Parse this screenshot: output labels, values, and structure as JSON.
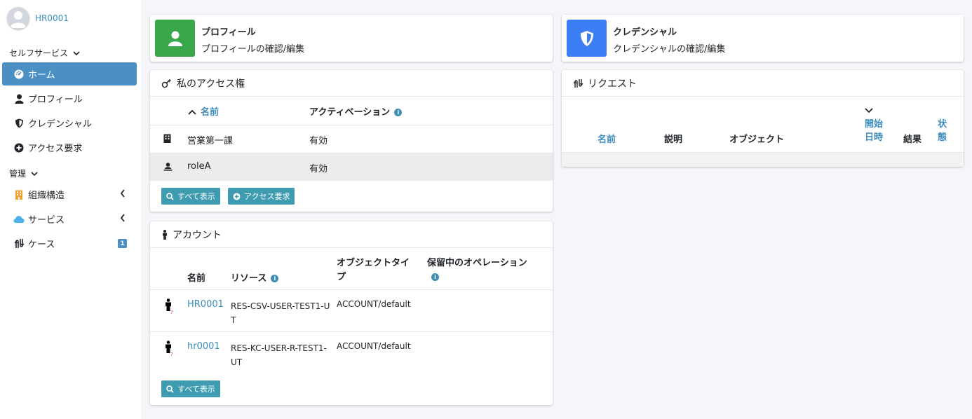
{
  "user": {
    "name": "HR0001"
  },
  "sidebar": {
    "self_service_label": "セルフサービス",
    "admin_label": "管理",
    "items": [
      {
        "label": "ホーム",
        "icon": "dashboard-icon",
        "active": true
      },
      {
        "label": "プロフィール",
        "icon": "user-icon"
      },
      {
        "label": "クレデンシャル",
        "icon": "shield-icon"
      },
      {
        "label": "アクセス要求",
        "icon": "plus-circle-icon"
      }
    ],
    "admin_items": [
      {
        "label": "組織構造",
        "icon": "building-icon"
      },
      {
        "label": "サービス",
        "icon": "cloud-icon"
      },
      {
        "label": "ケース",
        "icon": "case-icon",
        "badge": "1"
      }
    ]
  },
  "profile_box": {
    "title": "プロフィール",
    "subtitle": "プロフィールの確認/編集",
    "color": "#3aa84a"
  },
  "credential_box": {
    "title": "クレデンシャル",
    "subtitle": "クレデンシャルの確認/編集",
    "color": "#3c7ef3"
  },
  "access": {
    "title": "私のアクセス権",
    "col_name": "名前",
    "col_activation": "アクティベーション",
    "rows": [
      {
        "name": "営業第一課",
        "activation": "有効"
      },
      {
        "name": "roleA",
        "activation": "有効"
      }
    ],
    "btn_show_all": "すべて表示",
    "btn_request": "アクセス要求"
  },
  "accounts": {
    "title": "アカウント",
    "col_name": "名前",
    "col_resource": "リソース",
    "col_object_type_1": "オブジェクトタイ",
    "col_object_type_2": "プ",
    "col_pending": "保留中のオペレーション",
    "rows": [
      {
        "name": "HR0001",
        "resource_1": "RES-CSV-USER-TEST1-U",
        "resource_2": "T",
        "object_type": "ACCOUNT/default"
      },
      {
        "name": "hr0001",
        "resource_1": "RES-KC-USER-R-TEST1-",
        "resource_2": "UT",
        "object_type": "ACCOUNT/default"
      }
    ],
    "btn_show_all": "すべて表示"
  },
  "requests": {
    "title": "リクエスト",
    "col_name": "名前",
    "col_description": "説明",
    "col_object": "オブジェクト",
    "col_start_1": "開始",
    "col_start_2": "日時",
    "col_result": "結果",
    "col_status_1": "状",
    "col_status_2": "態"
  }
}
